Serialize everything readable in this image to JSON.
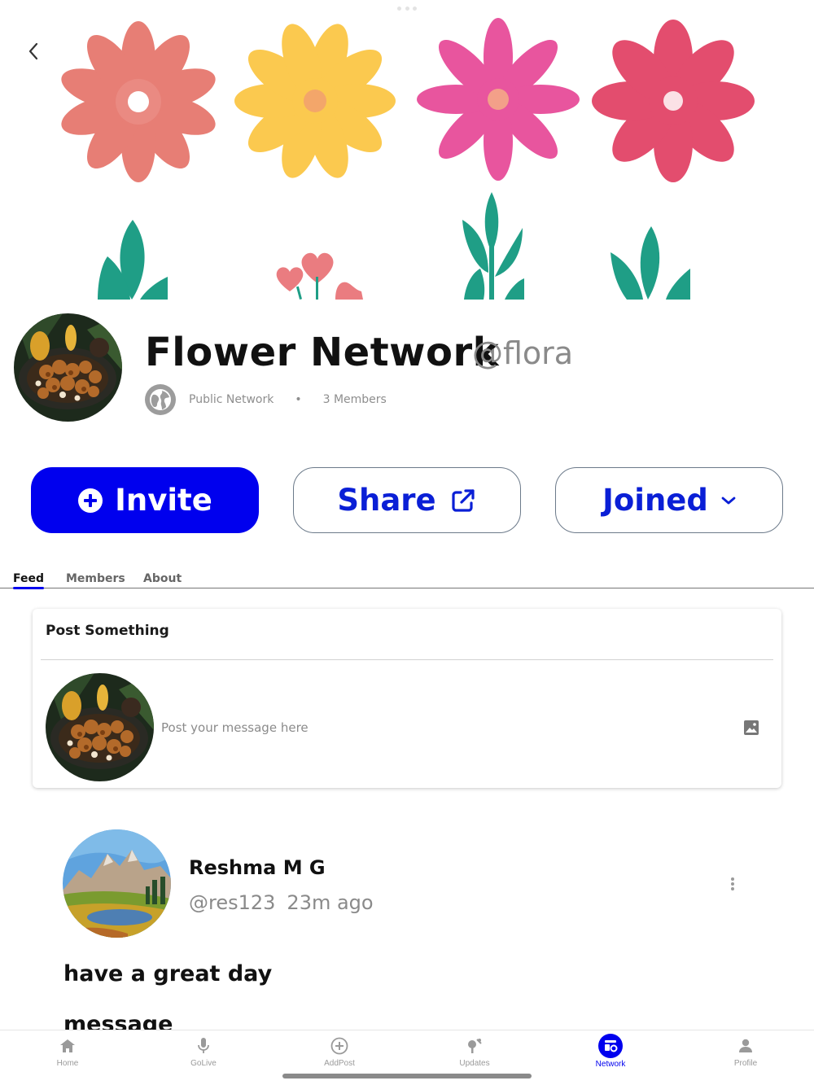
{
  "network": {
    "title": "Flower Network",
    "handle": "@flora",
    "visibility": "Public Network",
    "separator": "•",
    "members_count": "3 Members"
  },
  "actions": {
    "invite_label": "Invite",
    "share_label": "Share",
    "joined_label": "Joined"
  },
  "tabs": [
    {
      "label": "Feed",
      "active": true
    },
    {
      "label": "Members",
      "active": false
    },
    {
      "label": "About",
      "active": false
    }
  ],
  "composer": {
    "title": "Post Something",
    "placeholder": "Post your message here"
  },
  "post": {
    "author_name": "Reshma M G",
    "author_handle": "@res123",
    "time_ago": "23m ago",
    "text": "have a great day",
    "text_partial": "message"
  },
  "bottom_nav": [
    {
      "label": "Home",
      "icon": "home-icon"
    },
    {
      "label": "GoLive",
      "icon": "microphone-icon"
    },
    {
      "label": "AddPost",
      "icon": "plus-circle-icon"
    },
    {
      "label": "Updates",
      "icon": "updates-icon"
    },
    {
      "label": "Network",
      "icon": "network-icon",
      "active": true
    },
    {
      "label": "Profile",
      "icon": "profile-icon"
    }
  ],
  "colors": {
    "accent": "#0000ee",
    "link_blue": "#0a1fd6",
    "flower_coral": "#e77e75",
    "flower_yellow": "#fbc94f",
    "flower_pink": "#e8559e",
    "flower_red": "#e34d6e",
    "leaf_teal": "#1f9e86"
  }
}
